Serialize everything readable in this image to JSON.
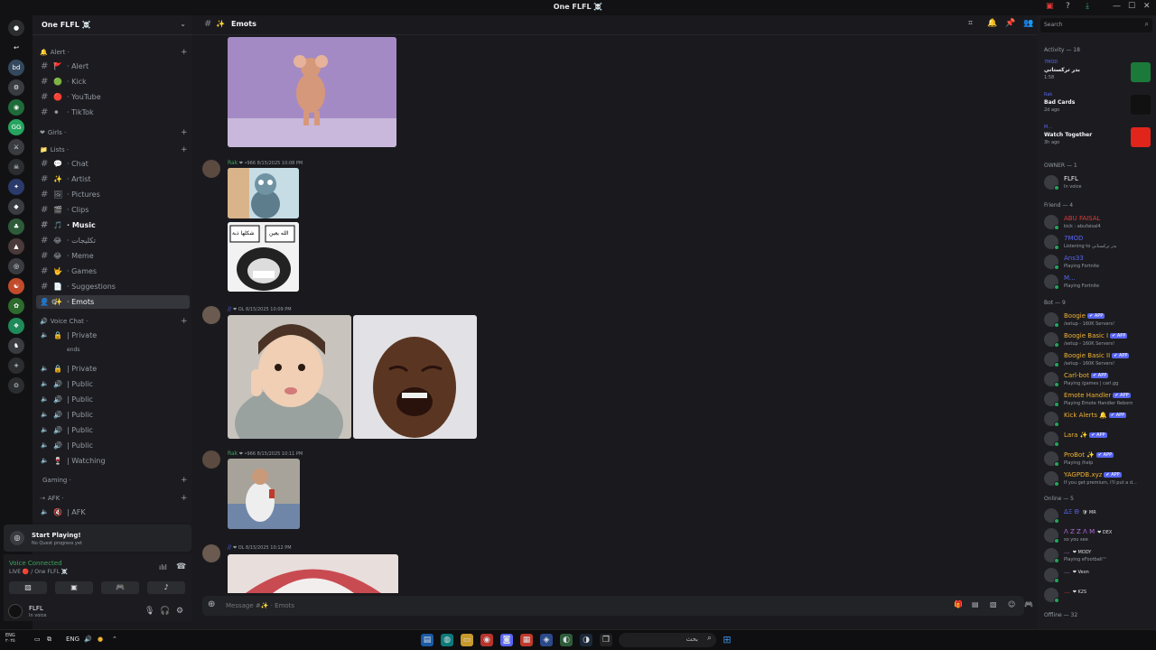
{
  "window": {
    "title": "One FLFL ☠️",
    "controls": [
      "—",
      "☐",
      "✕"
    ]
  },
  "servers": [
    {
      "label": "●",
      "color": "#2b2d31"
    },
    {
      "label": "↩",
      "color": "#121214"
    },
    {
      "label": "bd",
      "color": "#34495e"
    },
    {
      "label": "⚙",
      "color": "#3a3c42"
    },
    {
      "label": "◉",
      "color": "#1f6b3a"
    },
    {
      "label": "GG",
      "color": "#25a55f"
    },
    {
      "label": "⚔",
      "color": "#3a3c42"
    },
    {
      "label": "☠",
      "color": "#2b2d31"
    },
    {
      "label": "✦",
      "color": "#2a3a6a"
    },
    {
      "label": "◆",
      "color": "#3a3c42"
    },
    {
      "label": "♣",
      "color": "#2e5c3a"
    },
    {
      "label": "▲",
      "color": "#4a3a3a"
    },
    {
      "label": "◎",
      "color": "#3a3c42"
    },
    {
      "label": "☯",
      "color": "#c14b2b"
    },
    {
      "label": "✿",
      "color": "#2e6b2e"
    },
    {
      "label": "❖",
      "color": "#1f8a5a"
    },
    {
      "label": "♞",
      "color": "#3a3c42"
    },
    {
      "label": "+",
      "color": "#2b2d31"
    },
    {
      "label": "⊙",
      "color": "#2b2d31"
    }
  ],
  "sidebar": {
    "server_name": "One FLFL ☠️",
    "categories": [
      {
        "label": "Alert ·",
        "icon": "🔔"
      },
      {
        "label": "Girls ·",
        "icon": "❤"
      },
      {
        "label": "Lists ·",
        "icon": "📁"
      },
      {
        "label": "Voice Chat ·",
        "icon": "🔊"
      },
      {
        "label": "Gaming ·",
        "icon": ""
      },
      {
        "label": "AFK ·",
        "icon": "⇢"
      }
    ],
    "channels": [
      {
        "label": "· Alert",
        "icon": "🚩"
      },
      {
        "label": "· Kick",
        "icon": "🟢"
      },
      {
        "label": "· YouTube",
        "icon": "🔴"
      },
      {
        "label": "· TikTok",
        "icon": "⚫"
      },
      {
        "label": "· Chat",
        "icon": "💬"
      },
      {
        "label": "· Artist",
        "icon": "✨"
      },
      {
        "label": "· Pictures",
        "icon": "🖼"
      },
      {
        "label": "· Clips",
        "icon": "🎬"
      },
      {
        "label": "· Music",
        "icon": "🎵"
      },
      {
        "label": "· تكليجات",
        "icon": "😂"
      },
      {
        "label": "· Meme",
        "icon": "😂"
      },
      {
        "label": "· Games",
        "icon": "🤟"
      },
      {
        "label": "· Suggestions",
        "icon": "📄"
      },
      {
        "label": "· Emots",
        "icon": "✨"
      },
      {
        "label": "| Private",
        "icon": "🔒"
      },
      {
        "label": "| Private",
        "icon": "🔒"
      },
      {
        "label": "| Public",
        "icon": "🔊"
      },
      {
        "label": "| Public",
        "icon": "🔊"
      },
      {
        "label": "| Public",
        "icon": "🔊"
      },
      {
        "label": "| Public",
        "icon": "🔊"
      },
      {
        "label": "| Public",
        "icon": "🔊"
      },
      {
        "label": "| Watching",
        "icon": "🍷"
      },
      {
        "label": "| AFK",
        "icon": "🔇"
      }
    ],
    "voice_member": "ends",
    "quest": {
      "title": "Start Playing!",
      "sub": "No Quest progress yet"
    },
    "voice": {
      "status": "Voice Connected",
      "location": "LIVE 🔴 / One FLFL ☠️"
    },
    "user": {
      "name": "FLFL",
      "status": "In voice"
    }
  },
  "chat": {
    "channel": "Emots",
    "channel_icon": "✨",
    "messages": [
      {
        "author": "Rak",
        "badge": "❤ •966",
        "time": "8/15/2025 10:08 PM"
      },
      {
        "author": "// ",
        "badge": "❤ OL",
        "time": "8/15/2025 10:09 PM"
      },
      {
        "author": "Rak",
        "badge": "❤ •966",
        "time": "8/15/2025 10:11 PM"
      },
      {
        "author": "// ",
        "badge": "❤ OL",
        "time": "8/15/2025 10:12 PM"
      }
    ],
    "meme_text": [
      "الله يعين",
      "شكلها ذبة"
    ],
    "placeholder": "Message #✨ · Emots"
  },
  "right": {
    "search": "Search",
    "activity_header": "Activity — 18",
    "activities": [
      {
        "who": "7MOD",
        "title": "بدر تركستاني",
        "sub": "1:58",
        "thumb": "#1b7a3a"
      },
      {
        "who": "Rak",
        "title": "Bad Cards",
        "sub": "2d ago",
        "thumb": "#111"
      },
      {
        "who": "M...",
        "title": "Watch Together",
        "sub": "3h ago",
        "thumb": "#e1251b"
      }
    ],
    "owner_header": "OWNER — 1",
    "owner": [
      {
        "name": "FLFL",
        "sub": "In voice",
        "color": "#f2f3f5"
      }
    ],
    "friend_header": "Friend — 4",
    "friends": [
      {
        "name": "ABU FAISAL",
        "sub": "kick : abufaisal4",
        "color": "#e03a3a"
      },
      {
        "name": "7MOD",
        "sub": "Listening to بدر تركستاني",
        "color": "#5865f2"
      },
      {
        "name": "Ans33",
        "sub": "Playing Fortnite",
        "color": "#5865f2"
      },
      {
        "name": "M...",
        "sub": "Playing Fortnite",
        "color": "#5865f2"
      }
    ],
    "bot_header": "Bot — 9",
    "bots": [
      {
        "name": "Boogie",
        "sub": "/setup - 160K Servers!",
        "color": "#f0b232"
      },
      {
        "name": "Boogie Basic I",
        "sub": "/setup - 160K Servers!",
        "color": "#f0b232"
      },
      {
        "name": "Boogie Basic II",
        "sub": "/setup - 160K Servers!",
        "color": "#f0b232"
      },
      {
        "name": "Carl-bot",
        "sub": "Playing /games | carl.gg",
        "color": "#f0b232"
      },
      {
        "name": "Emote Handler",
        "sub": "Playing Emote Handler Reborn",
        "color": "#f0b232"
      },
      {
        "name": "Kick Alerts 🔔",
        "sub": "",
        "color": "#f0b232"
      },
      {
        "name": "Lara ✨",
        "sub": "",
        "color": "#f0b232"
      },
      {
        "name": "ProBot ✨",
        "sub": "Playing /help",
        "color": "#f0b232"
      },
      {
        "name": "YAGPDB.xyz",
        "sub": "If you get premium, I'll put a d...",
        "color": "#f0b232"
      }
    ],
    "app_tag": "✔ APP",
    "online_header": "Online — 5",
    "online": [
      {
        "name": "ΔΞ Θ",
        "sub": "",
        "tag": "🛡 MR",
        "color": "#5865f2"
      },
      {
        "name": "Λ Ζ Ζ Λ Μ",
        "sub": "so you see",
        "tag": "❤ DEX",
        "color": "#b46ae0"
      },
      {
        "name": "...",
        "sub": "Playing eFootball™",
        "tag": "❤ MODY",
        "color": "#b46ae0"
      },
      {
        "name": "...",
        "sub": "",
        "tag": "❤ Veon",
        "color": "#b46ae0"
      },
      {
        "name": "...",
        "sub": "",
        "tag": "❤ K2S",
        "color": "#e03a3a"
      }
    ],
    "offline_header": "Offline — 32"
  },
  "taskbar": {
    "search_placeholder": "بحث",
    "tray_text": "ENG"
  }
}
